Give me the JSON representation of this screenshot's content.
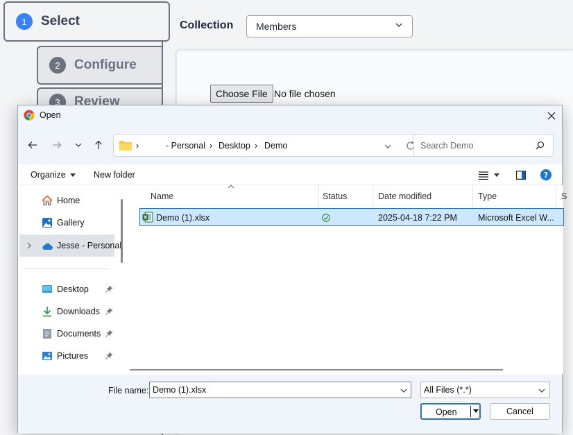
{
  "app": {
    "steps": [
      {
        "num": "1",
        "label": "Select"
      },
      {
        "num": "2",
        "label": "Configure"
      },
      {
        "num": "3",
        "label": "Review"
      }
    ],
    "collection_label": "Collection",
    "collection_value": "Members",
    "choose_file_label": "Choose File",
    "no_file_text": "No file chosen"
  },
  "dialog": {
    "title": "Open",
    "address": {
      "crumbs": [
        "- Personal",
        "Desktop",
        "Demo"
      ]
    },
    "search_placeholder": "Search Demo",
    "commands": {
      "organize": "Organize",
      "new_folder": "New folder"
    },
    "sidebar": {
      "quick": [
        {
          "label": "Home",
          "icon": "home-icon"
        },
        {
          "label": "Gallery",
          "icon": "gallery-icon"
        },
        {
          "label": "Jesse - Personal",
          "icon": "onedrive-cloud-icon"
        }
      ],
      "pinned": [
        {
          "label": "Desktop",
          "icon": "desktop-folder-icon"
        },
        {
          "label": "Downloads",
          "icon": "downloads-icon"
        },
        {
          "label": "Documents",
          "icon": "documents-icon"
        },
        {
          "label": "Pictures",
          "icon": "pictures-icon"
        }
      ]
    },
    "columns": {
      "name": "Name",
      "status": "Status",
      "date": "Date modified",
      "type": "Type",
      "size": "S"
    },
    "files": [
      {
        "name": "Demo (1).xlsx",
        "status_icon": "synced-check-icon",
        "date": "2025-04-18 7:22 PM",
        "type": "Microsoft Excel W..."
      }
    ],
    "file_name_label": "File name:",
    "file_name_value": "Demo (1).xlsx",
    "file_type_value": "All Files (*.*)",
    "open_label": "Open",
    "cancel_label": "Cancel",
    "colors": {
      "accent": "#2e73b8",
      "selection": "#cce8ff",
      "step_active": "#3b82f6"
    }
  }
}
